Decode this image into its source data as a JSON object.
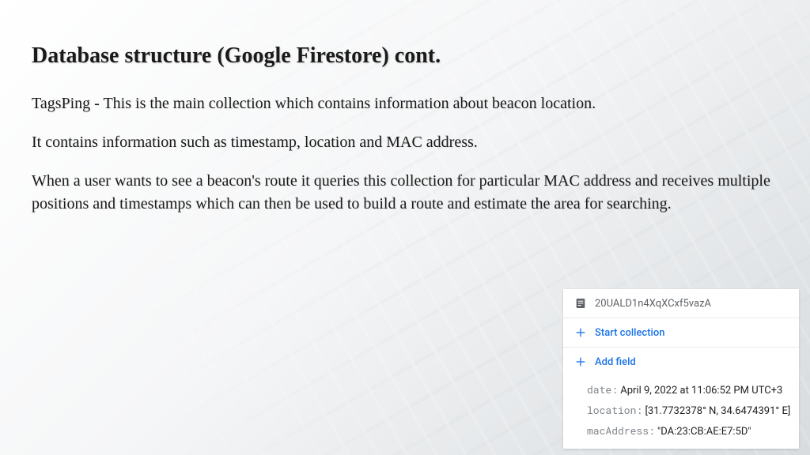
{
  "slide": {
    "title": "Database structure (Google Firestore) cont.",
    "para1": "TagsPing - This is the main collection which contains information about beacon location.",
    "para2": "It contains information such as timestamp, location and MAC address.",
    "para3": "When a user wants to see a beacon's route it queries this collection for particular MAC address and receives multiple positions and timestamps which can then be used to build a route and estimate the area for searching."
  },
  "panel": {
    "docId": "20UALD1n4XqXCxf5vazA",
    "startCollection": "Start collection",
    "addField": "Add field",
    "fields": {
      "dateKey": "date:",
      "dateVal": " April 9, 2022 at 11:06:52 PM UTC+3",
      "locationKey": "location:",
      "locationVal": " [31.7732378° N, 34.6474391° E]",
      "macKey": "macAddress:",
      "macVal": " \"DA:23:CB:AE:E7:5D\""
    }
  }
}
